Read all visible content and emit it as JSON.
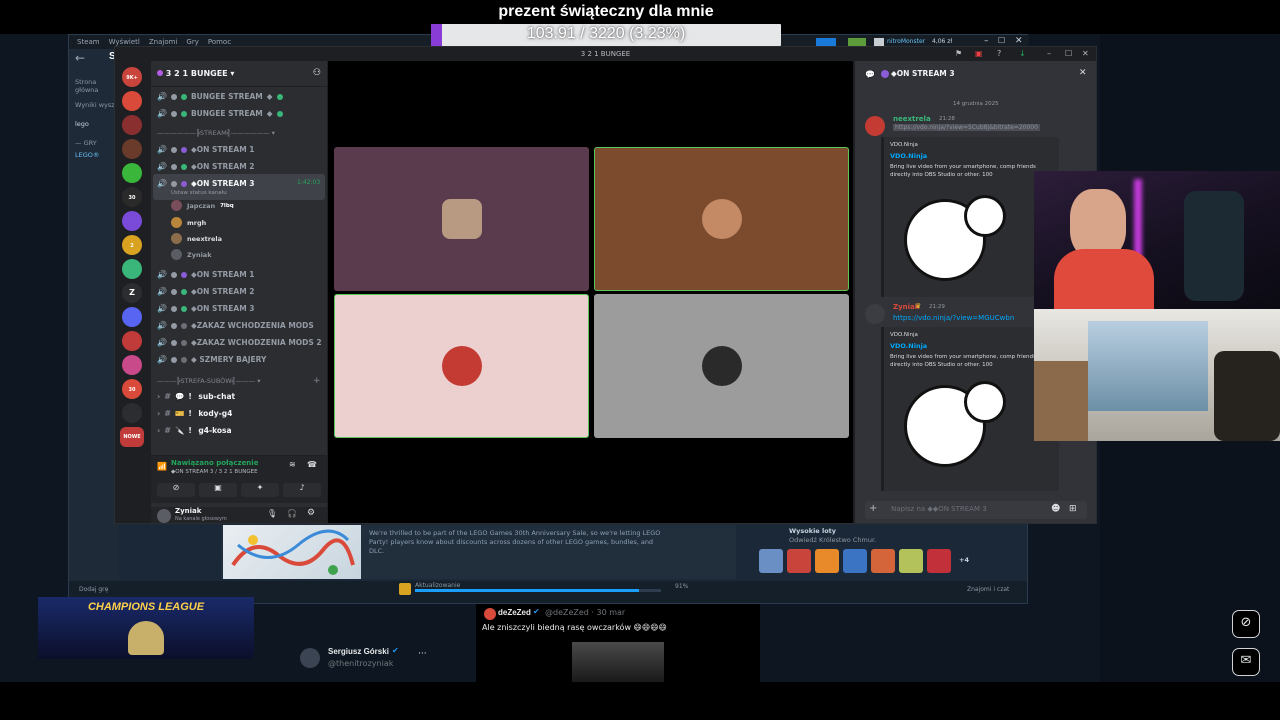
{
  "stream_goal": {
    "title": "prezent świąteczny dla mnie",
    "progress_text": "103.91 / 3220 (3.23%)",
    "progress": 0.0323
  },
  "steam": {
    "menu": [
      "Steam",
      "Wyświetl",
      "Znajomi",
      "Gry",
      "Pomoc"
    ],
    "nav_letter": "S",
    "side_labels": {
      "store": "Strona główna",
      "results": "Wyniki wysz",
      "search": "lego",
      "games_header": "— GRY",
      "game": "LEGO®"
    },
    "bottom": {
      "add_game": "Dodaj grę",
      "update_label": "Aktualizowanie",
      "update_percent": "91%",
      "update_progress": 0.91,
      "friends_chat": "Znajomi i czat"
    },
    "news_text": "We're thrilled to be part of the LEGO Games 30th Anniversary Sale, so we're letting LEGO Party! players know about discounts across dozens of other LEGO games, bundles, and DLC.",
    "achievements": {
      "title": "Wysokie loty",
      "subtitle": "Odwiedź Królestwo Chmur.",
      "more": "+4"
    },
    "tray": {
      "username": "nitroMonster",
      "balance": "4,06 zł"
    }
  },
  "discord": {
    "window_title": "3 2 1 BUNGEE",
    "server_name": "3 2 1 BUNGEE",
    "channels_top": [
      {
        "name": "BUNGEE STREAM",
        "suffix": "◆"
      },
      {
        "name": "BUNGEE STREAM",
        "suffix": "◆"
      }
    ],
    "section_stream": "STREAM",
    "stream_channels": [
      {
        "name": "◆ON STREAM 1"
      },
      {
        "name": "◆ON STREAM 2"
      },
      {
        "name": "◆ON STREAM 3",
        "time": "1:42:03",
        "status": "Ustaw status kanału"
      }
    ],
    "voice_users": [
      {
        "name": "Japczan",
        "tag": "7lbq"
      },
      {
        "name": "mrgh",
        "tag": ""
      },
      {
        "name": "neextrela",
        "tag": ""
      },
      {
        "name": "Zyniak",
        "tag": ""
      }
    ],
    "channels_mid": [
      {
        "name": "◆ON STREAM 1"
      },
      {
        "name": "◆ON STREAM 2"
      },
      {
        "name": "◆ON STREAM 3"
      },
      {
        "name": "◆ZAKAZ WCHODZENIA MODS"
      },
      {
        "name": "◆ZAKAZ WCHODZENIA MODS 2"
      },
      {
        "name": "◆ SZMERY BAJERY"
      }
    ],
    "section_strefa": "STREFA-SUBÓW",
    "text_channels": [
      "sub-chat",
      "kody-g4",
      "g4-kosa"
    ],
    "voice_connection": {
      "status": "Nawiązano połączenie",
      "location": "◆ON STREAM 3 / 3 2 1 BUNGEE"
    },
    "user": {
      "name": "Zyniak",
      "status": "Na kanale głosowym"
    },
    "guild_badges": [
      "9K+",
      "",
      "",
      "",
      "",
      "30",
      "",
      "2",
      "",
      "Z",
      "",
      "",
      "",
      "30",
      "",
      "NOWE"
    ],
    "chat": {
      "header": "◆ON STREAM 3",
      "date_divider": "14 grudnia 2025",
      "messages": [
        {
          "author": "neextrela",
          "time": "21:28",
          "link": "https://vdo.ninja/?view=5Cub8j&bitrate=20000",
          "embed_site": "VDO.Ninja",
          "embed_title": "VDO.Ninja",
          "embed_desc": "Bring live video from your smartphone, comp friends directly into OBS Studio or other. 100"
        },
        {
          "author": "Zyniak",
          "time": "21:29",
          "link": "https://vdo.ninja/?view=MGUCwbn",
          "embed_site": "VDO.Ninja",
          "embed_title": "VDO.Ninja",
          "embed_desc": "Bring live video from your smartphone, comp friends directly into OBS Studio or other. 100"
        }
      ],
      "input_placeholder": "Napisz na ◆◆ON STREAM 3"
    }
  },
  "twitter": {
    "author1": {
      "name": "Sergiusz Górski",
      "handle": "@thenitrozyniak",
      "more": "···"
    },
    "post": {
      "name": "deZeZed",
      "handle": "@deZeZed · 30 mar",
      "text": "Ale zniszczyli biedną rasę owczarków 😄😄😄😄"
    }
  },
  "overlay_banner": "CHAMPIONS LEAGUE",
  "colors": {
    "accent_purple": "#8a3cd6",
    "discord_green": "#23a55a",
    "link": "#00a8fc"
  }
}
